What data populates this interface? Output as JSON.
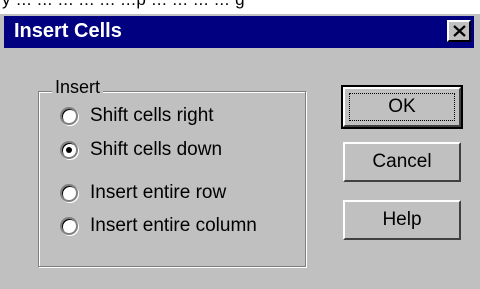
{
  "top_fragment": "y ... ... ... ... ... ...p ... ... ... ... g",
  "dialog": {
    "title": "Insert Cells",
    "close_glyph": "✕"
  },
  "insert_group": {
    "legend": "Insert",
    "options": [
      {
        "label": "Shift cells right",
        "selected": false
      },
      {
        "label": "Shift cells down",
        "selected": true
      },
      {
        "label": "Insert entire row",
        "selected": false
      },
      {
        "label": "Insert entire column",
        "selected": false
      }
    ]
  },
  "buttons": {
    "ok": "OK",
    "cancel": "Cancel",
    "help": "Help"
  },
  "colors": {
    "titlebar": "#000080",
    "face": "#c0c0c0"
  }
}
